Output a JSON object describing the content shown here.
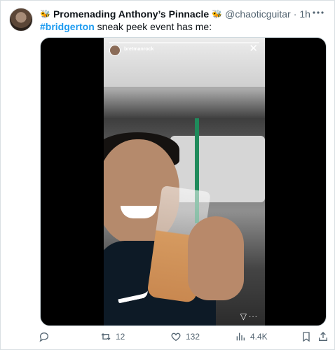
{
  "author": {
    "display_name": "Promenading Anthony’s Pinnacle",
    "emoji": "🐝",
    "handle": "@chaoticguitar",
    "separator": "·",
    "time": "1h"
  },
  "tweet": {
    "hashtag": "#bridgerton",
    "text": " sneak peek event has me:"
  },
  "media": {
    "story_user": "bretmanrock",
    "story_time": "1h",
    "close_glyph": "✕",
    "send_glyph": "▽",
    "dots_glyph": "···"
  },
  "actions": {
    "replies": "",
    "retweets": "12",
    "likes": "132",
    "views": "4.4K"
  },
  "colors": {
    "link": "#1d9bf0",
    "muted": "#536471",
    "text": "#0f1419"
  }
}
